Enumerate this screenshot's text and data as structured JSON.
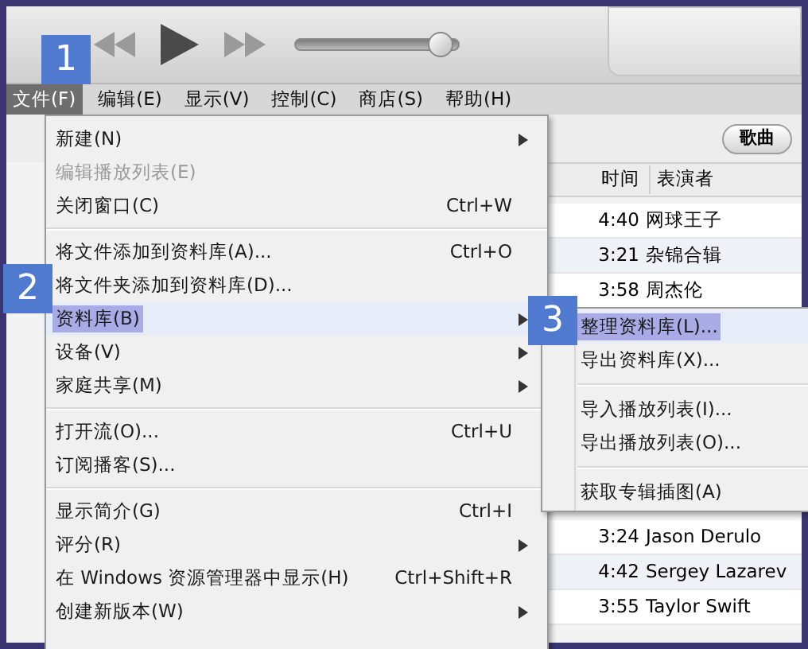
{
  "toolbar": {
    "volume": {
      "level": 0.88
    }
  },
  "menubar": [
    {
      "label": "文件(F)",
      "selected": true
    },
    {
      "label": "编辑(E)",
      "selected": false
    },
    {
      "label": "显示(V)",
      "selected": false
    },
    {
      "label": "控制(C)",
      "selected": false
    },
    {
      "label": "商店(S)",
      "selected": false
    },
    {
      "label": "帮助(H)",
      "selected": false
    }
  ],
  "view_button": "歌曲",
  "table": {
    "columns": [
      "时间",
      "表演者"
    ],
    "rows_above_submenu": [
      {
        "time": "4:40",
        "artist": "网球王子"
      },
      {
        "time": "3:21",
        "artist": "杂锦合辑"
      },
      {
        "time": "3:58",
        "artist": "周杰伦"
      }
    ],
    "rows_below_submenu": [
      {
        "time": "3:24",
        "artist": "Jason Derulo"
      },
      {
        "time": "4:42",
        "artist": "Sergey Lazarev"
      },
      {
        "time": "3:55",
        "artist": "Taylor Swift"
      }
    ]
  },
  "file_menu": [
    {
      "kind": "item",
      "label": "新建(N)",
      "submenu": true,
      "disabled": false,
      "selected": false
    },
    {
      "kind": "item",
      "label": "编辑播放列表(E)",
      "submenu": false,
      "disabled": true,
      "selected": false
    },
    {
      "kind": "item",
      "label": "关闭窗口(C)",
      "shortcut": "Ctrl+W",
      "submenu": false,
      "disabled": false,
      "selected": false
    },
    {
      "kind": "separator"
    },
    {
      "kind": "item",
      "label": "将文件添加到资料库(A)...",
      "shortcut": "Ctrl+O",
      "submenu": false,
      "disabled": false,
      "selected": false
    },
    {
      "kind": "item",
      "label": "将文件夹添加到资料库(D)...",
      "submenu": false,
      "disabled": false,
      "selected": false
    },
    {
      "kind": "item",
      "label": "资料库(B)",
      "submenu": true,
      "disabled": false,
      "selected": true
    },
    {
      "kind": "item",
      "label": "设备(V)",
      "submenu": true,
      "disabled": false,
      "selected": false
    },
    {
      "kind": "item",
      "label": "家庭共享(M)",
      "submenu": true,
      "disabled": false,
      "selected": false
    },
    {
      "kind": "separator"
    },
    {
      "kind": "item",
      "label": "打开流(O)...",
      "shortcut": "Ctrl+U",
      "submenu": false,
      "disabled": false,
      "selected": false
    },
    {
      "kind": "item",
      "label": "订阅播客(S)...",
      "submenu": false,
      "disabled": false,
      "selected": false
    },
    {
      "kind": "separator"
    },
    {
      "kind": "item",
      "label": "显示简介(G)",
      "shortcut": "Ctrl+I",
      "submenu": false,
      "disabled": false,
      "selected": false
    },
    {
      "kind": "item",
      "label": "评分(R)",
      "submenu": true,
      "disabled": false,
      "selected": false
    },
    {
      "kind": "item",
      "label": "在 Windows 资源管理器中显示(H)",
      "shortcut": "Ctrl+Shift+R",
      "submenu": false,
      "disabled": false,
      "selected": false
    },
    {
      "kind": "item",
      "label": "创建新版本(W)",
      "submenu": true,
      "disabled": false,
      "selected": false
    }
  ],
  "library_submenu": [
    {
      "kind": "item",
      "label": "整理资料库(L)...",
      "selected": true
    },
    {
      "kind": "item",
      "label": "导出资料库(X)...",
      "selected": false
    },
    {
      "kind": "separator"
    },
    {
      "kind": "item",
      "label": "导入播放列表(I)...",
      "selected": false
    },
    {
      "kind": "item",
      "label": "导出播放列表(O)...",
      "selected": false
    },
    {
      "kind": "separator"
    },
    {
      "kind": "item",
      "label": "获取专辑插图(A)",
      "selected": false
    }
  ],
  "step_badges": [
    "1",
    "2",
    "3"
  ]
}
